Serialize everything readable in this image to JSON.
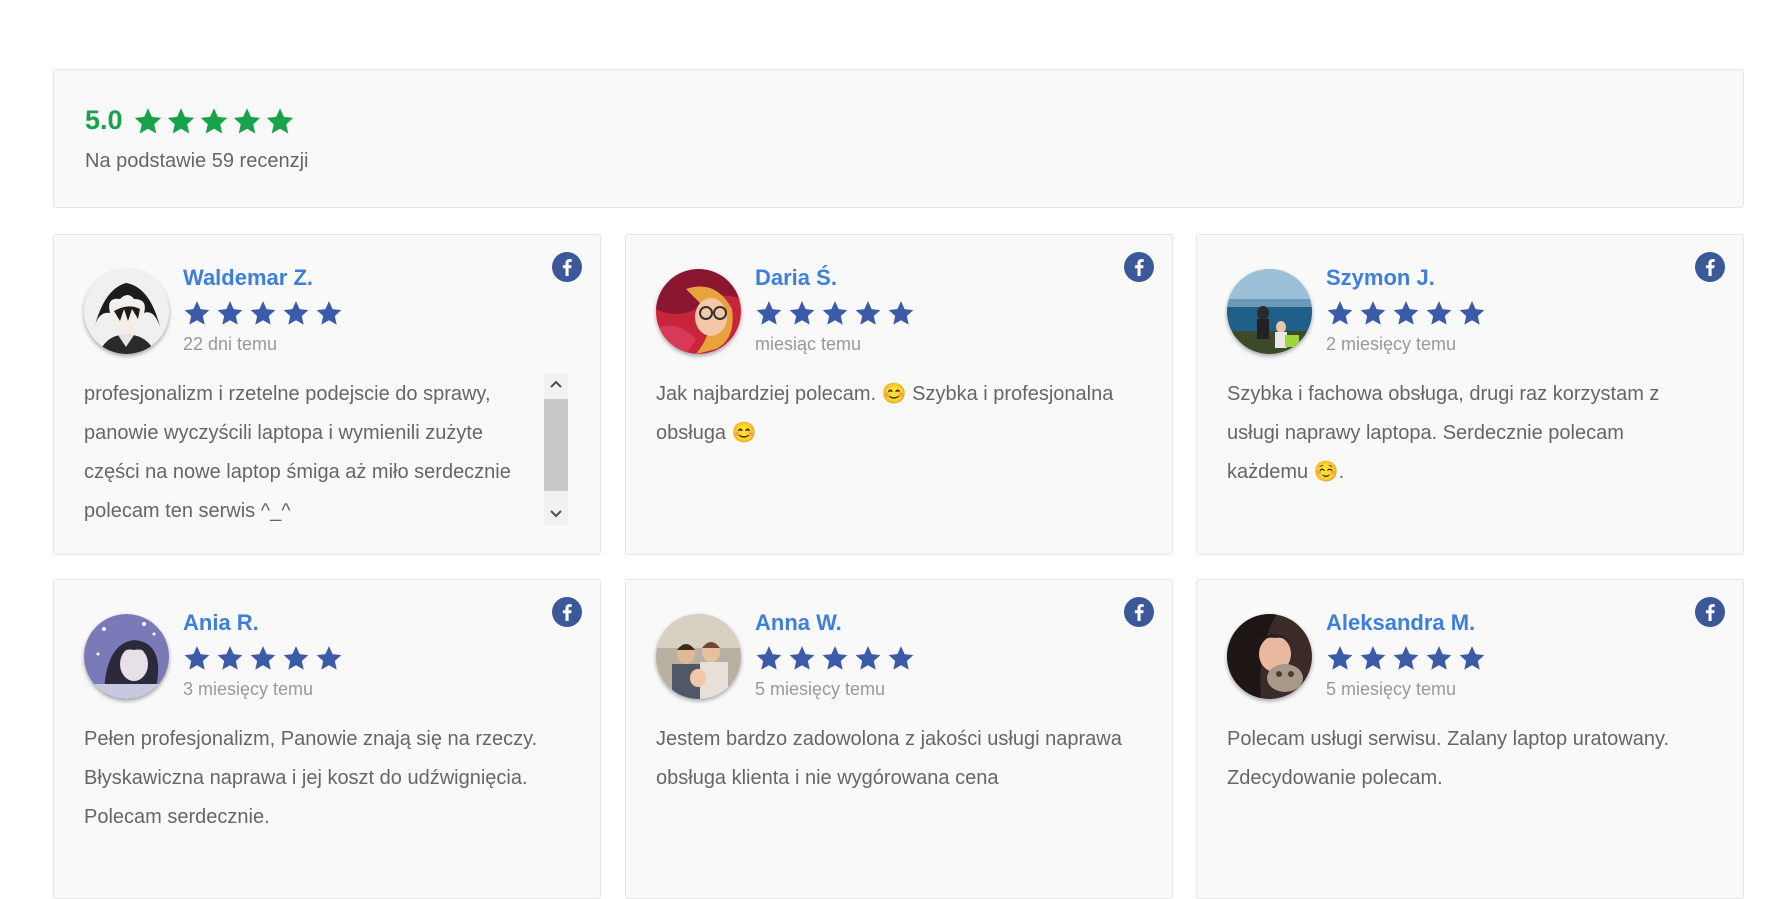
{
  "summary": {
    "score": "5.0",
    "stars": 5,
    "based_on": "Na podstawie 59 recenzji",
    "color": "#17a34a"
  },
  "reviews": [
    {
      "name": "Waldemar Z.",
      "time": "22 dni temu",
      "stars": 5,
      "text": "profesjonalizm i rzetelne podejscie do sprawy, panowie wyczyścili laptopa i wymienili zużyte części na nowe laptop śmiga aż miło serdecznie polecam ten serwis ^_^",
      "source_icon": "facebook-icon"
    },
    {
      "name": "Daria Ś.",
      "time": "miesiąc temu",
      "stars": 5,
      "text": "Jak najbardziej polecam. 😊 Szybka i profesjonalna obsługa 😊",
      "source_icon": "facebook-icon"
    },
    {
      "name": "Szymon J.",
      "time": "2 miesięcy temu",
      "stars": 5,
      "text": "Szybka i fachowa obsługa, drugi raz korzystam z usługi naprawy laptopa. Serdecznie polecam każdemu ☺️.",
      "source_icon": "facebook-icon"
    },
    {
      "name": "Ania R.",
      "time": "3 miesięcy temu",
      "stars": 5,
      "text": "Pełen profesjonalizm, Panowie znają się na rzeczy. Błyskawiczna naprawa i jej koszt do udźwignięcia. Polecam serdecznie.",
      "source_icon": "facebook-icon"
    },
    {
      "name": "Anna W.",
      "time": "5 miesięcy temu",
      "stars": 5,
      "text": "Jestem bardzo zadowolona z jakości usługi naprawa obsługa klienta i nie wygórowana cena",
      "source_icon": "facebook-icon"
    },
    {
      "name": "Aleksandra M.",
      "time": "5 miesięcy temu",
      "stars": 5,
      "text": "Polecam usługi serwisu. Zalany laptop uratowany. Zdecydowanie polecam.",
      "source_icon": "facebook-icon"
    }
  ],
  "colors": {
    "name": "#3d7fd9",
    "review_star": "#3b5aa8",
    "facebook": "#3b5998"
  }
}
